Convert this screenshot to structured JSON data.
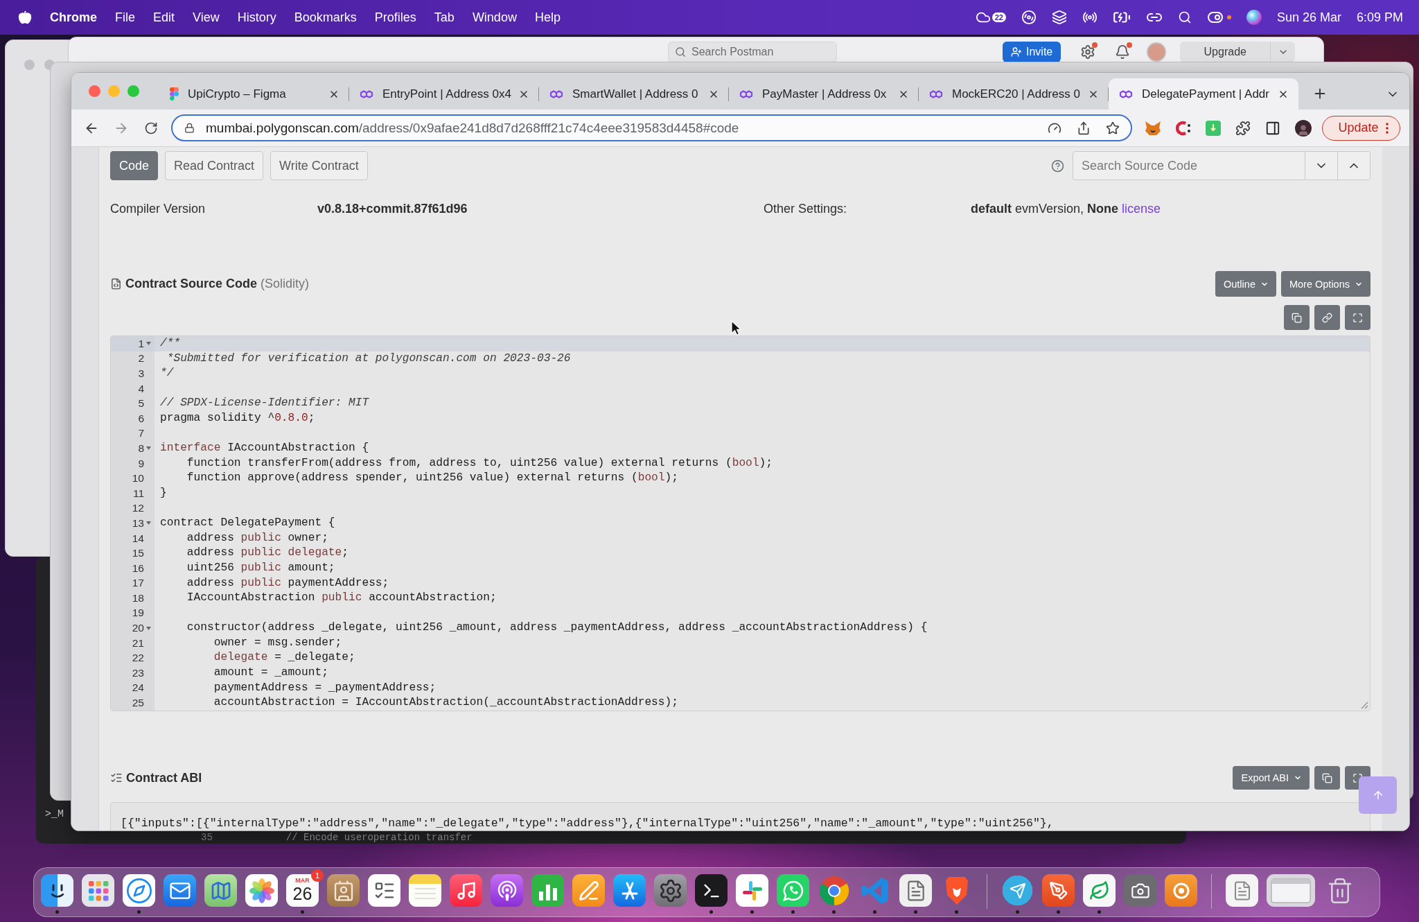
{
  "menu_bar": {
    "app": "Chrome",
    "menus": [
      "File",
      "Edit",
      "View",
      "History",
      "Bookmarks",
      "Profiles",
      "Tab",
      "Window",
      "Help"
    ],
    "notification_count": "22",
    "date": "Sun 26 Mar",
    "time": "6:09 PM"
  },
  "background_windows": {
    "postman": {
      "search_placeholder": "Search Postman",
      "invite_button": "Invite",
      "upgrade_button": "Upgrade"
    },
    "terminal": {
      "label": ">_M",
      "line_number": "35",
      "code": "// Encode useroperation transfer"
    }
  },
  "browser": {
    "tabs": [
      {
        "title": "UpiCrypto – Figma",
        "kind": "figma",
        "selected": false
      },
      {
        "title": "EntryPoint | Address 0x4",
        "kind": "polygon",
        "selected": false
      },
      {
        "title": "SmartWallet | Address 0",
        "kind": "polygon",
        "selected": false
      },
      {
        "title": "PayMaster | Address 0x",
        "kind": "polygon",
        "selected": false
      },
      {
        "title": "MockERC20 | Address 0",
        "kind": "polygon",
        "selected": false
      },
      {
        "title": "DelegatePayment | Addr",
        "kind": "polygon",
        "selected": true
      }
    ],
    "address": {
      "domain": "mumbai.polygonscan.com",
      "path": "/address/0x9afae241d8d7d268fff21c74c4eee319583d4458#code"
    },
    "update_button": "Update"
  },
  "page": {
    "view_tabs": [
      {
        "label": "Code",
        "selected": true
      },
      {
        "label": "Read Contract",
        "selected": false
      },
      {
        "label": "Write Contract",
        "selected": false
      }
    ],
    "search": {
      "placeholder": "Search Source Code"
    },
    "compiler_version": {
      "label": "Compiler Version",
      "value": "v0.8.18+commit.87f61d96"
    },
    "other_settings": {
      "label": "Other Settings:",
      "value": "**default** evmVersion, **None**",
      "link": "license"
    },
    "source_code": {
      "title": "Contract Source Code",
      "language": "(Solidity)",
      "menus": [
        "Outline",
        "More Options"
      ],
      "lines": [
        {
          "number": "1",
          "fold": true,
          "active": true,
          "segments": [
            {
              "kind": "comment",
              "text": "/**"
            }
          ]
        },
        {
          "number": "2",
          "fold": false,
          "active": false,
          "segments": [
            {
              "kind": "comment",
              "text": " *Submitted for verification at polygonscan.com on 2023-03-26"
            }
          ]
        },
        {
          "number": "3",
          "fold": false,
          "active": false,
          "segments": [
            {
              "kind": "comment",
              "text": "*/"
            }
          ]
        },
        {
          "number": "4",
          "fold": false,
          "active": false
        },
        {
          "number": "5",
          "fold": false,
          "active": false,
          "segments": [
            {
              "kind": "comment",
              "text": "// SPDX-License-Identifier: MIT"
            }
          ]
        },
        {
          "number": "6",
          "fold": false,
          "active": false,
          "segments": [
            {
              "kind": "plain",
              "text": "pragma solidity ^"
            },
            {
              "kind": "number",
              "text": "0.8.0"
            },
            {
              "kind": "plain",
              "text": ";"
            }
          ]
        },
        {
          "number": "7",
          "fold": false,
          "active": false
        },
        {
          "number": "8",
          "fold": true,
          "active": false,
          "segments": [
            {
              "kind": "keyword",
              "text": "interface"
            },
            {
              "kind": "plain",
              "text": " IAccountAbstraction {"
            }
          ]
        },
        {
          "number": "9",
          "fold": false,
          "active": false,
          "segments": [
            {
              "kind": "plain",
              "text": "    function transferFrom(address from, address to, uint256 value) external returns ("
            },
            {
              "kind": "keyword",
              "text": "bool"
            },
            {
              "kind": "plain",
              "text": ");"
            }
          ]
        },
        {
          "number": "10",
          "fold": false,
          "active": false,
          "segments": [
            {
              "kind": "plain",
              "text": "    function approve(address spender, uint256 value) external returns ("
            },
            {
              "kind": "keyword",
              "text": "bool"
            },
            {
              "kind": "plain",
              "text": ");"
            }
          ]
        },
        {
          "number": "11",
          "fold": false,
          "active": false,
          "segments": [
            {
              "kind": "plain",
              "text": "}"
            }
          ]
        },
        {
          "number": "12",
          "fold": false,
          "active": false
        },
        {
          "number": "13",
          "fold": true,
          "active": false,
          "segments": [
            {
              "kind": "plain",
              "text": "contract DelegatePayment {"
            }
          ]
        },
        {
          "number": "14",
          "fold": false,
          "active": false,
          "segments": [
            {
              "kind": "plain",
              "text": "    address "
            },
            {
              "kind": "keyword",
              "text": "public"
            },
            {
              "kind": "plain",
              "text": " owner;"
            }
          ]
        },
        {
          "number": "15",
          "fold": false,
          "active": false,
          "segments": [
            {
              "kind": "plain",
              "text": "    address "
            },
            {
              "kind": "keyword",
              "text": "public delegate"
            },
            {
              "kind": "plain",
              "text": ";"
            }
          ]
        },
        {
          "number": "16",
          "fold": false,
          "active": false,
          "segments": [
            {
              "kind": "plain",
              "text": "    uint256 "
            },
            {
              "kind": "keyword",
              "text": "public"
            },
            {
              "kind": "plain",
              "text": " amount;"
            }
          ]
        },
        {
          "number": "17",
          "fold": false,
          "active": false,
          "segments": [
            {
              "kind": "plain",
              "text": "    address "
            },
            {
              "kind": "keyword",
              "text": "public"
            },
            {
              "kind": "plain",
              "text": " paymentAddress;"
            }
          ]
        },
        {
          "number": "18",
          "fold": false,
          "active": false,
          "segments": [
            {
              "kind": "plain",
              "text": "    IAccountAbstraction "
            },
            {
              "kind": "keyword",
              "text": "public"
            },
            {
              "kind": "plain",
              "text": " accountAbstraction;"
            }
          ]
        },
        {
          "number": "19",
          "fold": false,
          "active": false
        },
        {
          "number": "20",
          "fold": true,
          "active": false,
          "segments": [
            {
              "kind": "plain",
              "text": "    constructor(address _delegate, uint256 _amount, address _paymentAddress, address _accountAbstractionAddress) {"
            }
          ]
        },
        {
          "number": "21",
          "fold": false,
          "active": false,
          "segments": [
            {
              "kind": "plain",
              "text": "        owner = msg.sender;"
            }
          ]
        },
        {
          "number": "22",
          "fold": false,
          "active": false,
          "segments": [
            {
              "kind": "keyword",
              "text": "        delegate"
            },
            {
              "kind": "plain",
              "text": " = _delegate;"
            }
          ]
        },
        {
          "number": "23",
          "fold": false,
          "active": false,
          "segments": [
            {
              "kind": "plain",
              "text": "        amount = _amount;"
            }
          ]
        },
        {
          "number": "24",
          "fold": false,
          "active": false,
          "segments": [
            {
              "kind": "plain",
              "text": "        paymentAddress = _paymentAddress;"
            }
          ]
        },
        {
          "number": "25",
          "fold": false,
          "active": false,
          "segments": [
            {
              "kind": "plain",
              "text": "        accountAbstraction = IAccountAbstraction(_accountAbstractionAddress);"
            }
          ]
        }
      ]
    },
    "abi": {
      "title": "Contract ABI",
      "export_button": "Export ABI",
      "text": "[{\"inputs\":[{\"internalType\":\"address\",\"name\":\"_delegate\",\"type\":\"address\"},{\"internalType\":\"uint256\",\"name\":\"_amount\",\"type\":\"uint256\"},"
    }
  },
  "dock": {
    "apps": [
      {
        "kind": "finder",
        "running": true
      },
      {
        "kind": "launchpad",
        "running": false
      },
      {
        "kind": "safari",
        "running": true
      },
      {
        "kind": "mail",
        "running": false
      },
      {
        "kind": "maps",
        "running": false
      },
      {
        "kind": "photos",
        "running": false
      },
      {
        "kind": "calendar",
        "running": true,
        "month": "MAR",
        "day": "26",
        "badge": "1"
      },
      {
        "kind": "contacts",
        "running": false
      },
      {
        "kind": "reminders",
        "running": false
      },
      {
        "kind": "notes",
        "running": false
      },
      {
        "kind": "music",
        "running": false
      },
      {
        "kind": "podcasts",
        "running": false
      },
      {
        "kind": "numbers",
        "running": false
      },
      {
        "kind": "pages",
        "running": false
      },
      {
        "kind": "app_store",
        "running": false
      },
      {
        "kind": "system_settings",
        "running": false
      },
      {
        "kind": "terminal",
        "running": true
      },
      {
        "kind": "slack",
        "running": true
      },
      {
        "kind": "whatsapp",
        "running": true
      },
      {
        "kind": "chrome",
        "running": true
      },
      {
        "kind": "vscode",
        "running": true
      },
      {
        "kind": "script_editor",
        "running": true
      },
      {
        "kind": "brave",
        "running": true
      }
    ],
    "recent": [
      {
        "kind": "telegram",
        "running": true
      },
      {
        "kind": "pen_app",
        "running": true
      },
      {
        "kind": "mongodb",
        "running": true
      },
      {
        "kind": "camera",
        "running": false
      },
      {
        "kind": "recorder",
        "running": false
      }
    ],
    "stacks": [
      {
        "kind": "document"
      },
      {
        "kind": "window"
      },
      {
        "kind": "trash"
      }
    ]
  }
}
